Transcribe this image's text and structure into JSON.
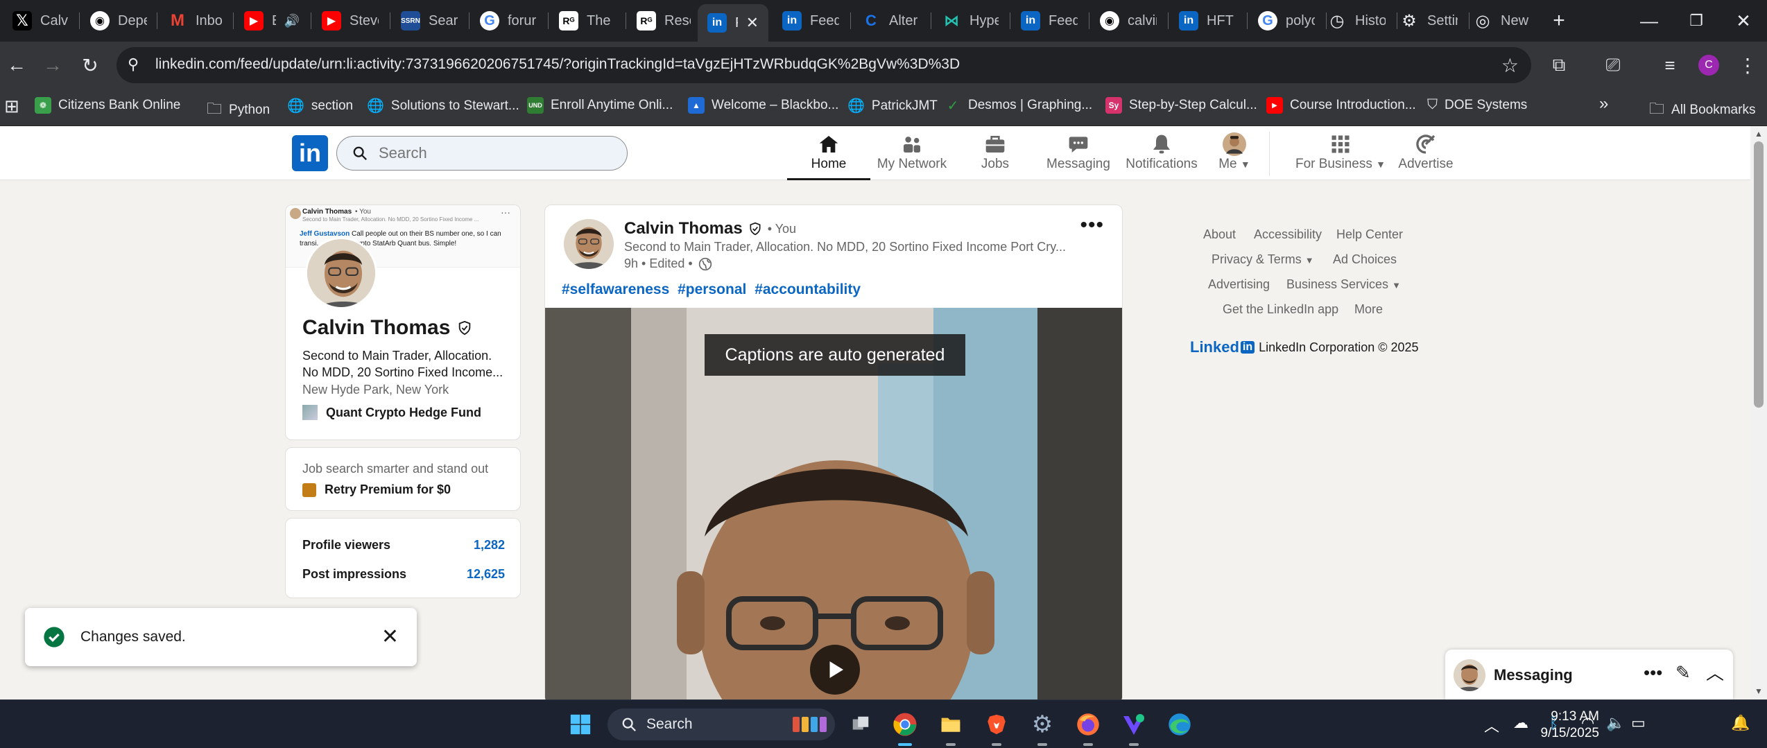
{
  "browser": {
    "tabs": [
      {
        "label": "Calvi",
        "icon": "x-icon",
        "color": "#000000"
      },
      {
        "label": "Depe",
        "icon": "github-icon",
        "color": "#24292f"
      },
      {
        "label": "Inbo",
        "icon": "gmail-icon",
        "color": "#ea4335"
      },
      {
        "label": "B",
        "icon": "youtube-icon",
        "color": "#ff0000"
      },
      {
        "label": "Steve",
        "icon": "youtube-icon",
        "color": "#ff0000"
      },
      {
        "label": "Searc",
        "icon": "ssrn-icon",
        "color": "#1f4e96"
      },
      {
        "label": "forur",
        "icon": "google-icon",
        "color": "#4285f4"
      },
      {
        "label": "The F",
        "icon": "rg-icon",
        "color": "#3a3a3a"
      },
      {
        "label": "Resea",
        "icon": "rg-icon",
        "color": "#3a3a3a"
      },
      {
        "label": "F",
        "icon": "linkedin-icon",
        "color": "#0a66c2"
      },
      {
        "label": "Feed",
        "icon": "linkedin-icon",
        "color": "#0a66c2"
      },
      {
        "label": "Alter",
        "icon": "alter-icon",
        "color": "#1a73e8"
      },
      {
        "label": "Hype",
        "icon": "hype-icon",
        "color": "#22c1b0"
      },
      {
        "label": "Feed",
        "icon": "linkedin-icon",
        "color": "#0a66c2"
      },
      {
        "label": "calvir",
        "icon": "github-icon",
        "color": "#24292f"
      },
      {
        "label": "HFT (",
        "icon": "linkedin-icon",
        "color": "#0a66c2"
      },
      {
        "label": "polyc",
        "icon": "google-icon",
        "color": "#4285f4"
      },
      {
        "label": "Histo",
        "icon": "history-icon",
        "color": "#5f6368"
      },
      {
        "label": "Settir",
        "icon": "gear-icon",
        "color": "#5f6368"
      },
      {
        "label": "New",
        "icon": "chrome-icon",
        "color": "#5f6368"
      }
    ],
    "url": "linkedin.com/feed/update/urn:li:activity:7373196620206751745/?originTrackingId=taVgzEjHTzWRbudqGK%2BgVw%3D%3D",
    "bookmarks": [
      {
        "label": "Citizens Bank Online",
        "color": "#3a9f4a"
      },
      {
        "label": "Python",
        "color": "folder"
      },
      {
        "label": "section",
        "color": "globe"
      },
      {
        "label": "Solutions to Stewart...",
        "color": "globe"
      },
      {
        "label": "Enroll Anytime Onli...",
        "color": "#2f7d32",
        "tag": "UND"
      },
      {
        "label": "Welcome – Blackbo...",
        "color": "#1e6bd6"
      },
      {
        "label": "PatrickJMT",
        "color": "globe"
      },
      {
        "label": "Desmos | Graphing...",
        "color": "#2f9e44"
      },
      {
        "label": "Step-by-Step Calcul...",
        "color": "#d6336c",
        "tag": "Sy"
      },
      {
        "label": "Course Introduction...",
        "color": "#ff0000"
      },
      {
        "label": "DOE Systems",
        "color": "shield"
      }
    ],
    "all_bookmarks": "All Bookmarks"
  },
  "linkedin": {
    "search_placeholder": "Search",
    "nav": [
      {
        "label": "Home",
        "icon": "home-icon"
      },
      {
        "label": "My Network",
        "icon": "network-icon"
      },
      {
        "label": "Jobs",
        "icon": "briefcase-icon"
      },
      {
        "label": "Messaging",
        "icon": "chat-icon"
      },
      {
        "label": "Notifications",
        "icon": "bell-icon"
      },
      {
        "label": "Me",
        "icon": "avatar"
      },
      {
        "label": "For Business",
        "icon": "grid-icon"
      },
      {
        "label": "Advertise",
        "icon": "advertise-icon"
      }
    ],
    "profile": {
      "banner_name": "Calvin Thomas",
      "banner_you": "• You",
      "banner_headline": "Second to Main Trader, Allocation. No MDD, 20 Sortino Fixed Income ...",
      "banner_mention": "Jeff Gustavson",
      "banner_text": "Call people out on their BS number one, so I can",
      "banner_text2": "transi... my own Crypto StatArb Quant bus. Simple!",
      "name": "Calvin Thomas",
      "headline": "Second to Main Trader, Allocation. No MDD, 20 Sortino Fixed Income...",
      "location": "New Hyde Park, New York",
      "company": "Quant Crypto Hedge Fund"
    },
    "premium": {
      "text": "Job search smarter and stand out",
      "cta": "Retry Premium for $0"
    },
    "stats": [
      {
        "label": "Profile viewers",
        "value": "1,282"
      },
      {
        "label": "Post impressions",
        "value": "12,625"
      }
    ],
    "toast": "Changes saved.",
    "post": {
      "name": "Calvin Thomas",
      "you": "• You",
      "headline": "Second to Main Trader, Allocation. No MDD, 20 Sortino Fixed Income Port Cry...",
      "time": "9h • Edited •",
      "hashtags": [
        "#selfawareness",
        "#personal",
        "#accountability"
      ],
      "caption": "Captions are auto generated"
    },
    "footer": {
      "links": [
        "About",
        "Accessibility",
        "Help Center",
        "Privacy & Terms",
        "Ad Choices",
        "Advertising",
        "Business Services",
        "Get the LinkedIn app",
        "More"
      ],
      "logo_text": "Linked",
      "logo_in": "in",
      "copyright": "LinkedIn Corporation © 2025"
    },
    "messaging": "Messaging"
  },
  "taskbar": {
    "search": "Search",
    "time": "9:13 AM",
    "date": "9/15/2025"
  }
}
